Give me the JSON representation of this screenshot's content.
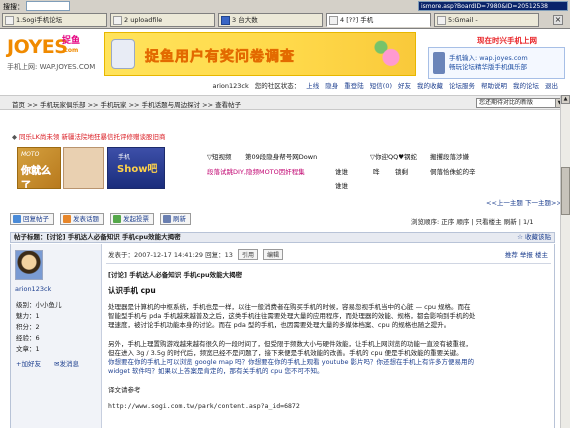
{
  "browser": {
    "search_label": "搜搜：",
    "address_url": "ismore.asp?BoardID=7980&ID=20512538",
    "tabs": [
      {
        "label": "1.Sogi手机论坛"
      },
      {
        "label": "2 uploadfile"
      },
      {
        "label": "3 台大数"
      },
      {
        "label": "4 [??] 手机"
      },
      {
        "label": "5:Gmail -"
      }
    ],
    "close_glyph": "×"
  },
  "header": {
    "logo_text": "JOYES",
    "logo_cn": "捉鱼",
    "logo_cn_sub": ".com",
    "site_url": "手机上网: WAP.JOYES.COM",
    "banner_text": "捉鱼用户有奖问卷调查",
    "promo_top": "现在时兴手机上网",
    "promo_line1": "手机输入: wap.joyes.com",
    "promo_line2": "畅玩论坛精华版手机俱乐部"
  },
  "userbar": {
    "user": "arion123ck",
    "greeting": "您的社区状态：",
    "items": [
      "上线",
      "隐身",
      "重登陆",
      "短信(0)",
      "好友",
      "我的收藏",
      "论坛服务",
      "帮助说明",
      "我的论坛",
      "退出"
    ]
  },
  "nav": {
    "breadcrumb": "首页 >> 手机玩家俱乐部 >> 手机玩家 >> 手机话题与周边探讨 >> 查看帖子",
    "sort_select": "您还期待对比的新版"
  },
  "announce": {
    "text": "同乐LK尚未领  新疆法院地狂暴信托评修赠谈股旧商"
  },
  "ads": {
    "img1_moto": "MOTO",
    "img1_text": "你就么了",
    "img3_sub": "手机",
    "img3_text": "Show吧",
    "links_row1": [
      "▽短视频",
      "第09段隐身帮号网Down",
      "▽你迎QQ♥钢蛇",
      "搬攫段落涉嫌"
    ],
    "links_row2": [
      "段落试跳DIY,隐频MOTO因奸程集",
      "谁谁",
      "哗",
      "锁剩",
      "侗落恰侏蛇的辛"
    ],
    "links_row3": [
      "",
      "谁谁",
      "",
      ""
    ]
  },
  "pagination": {
    "prev_next": "<<上一主题  下一主题>>",
    "view_modes": "浏览顺序: 正序  顺序  |  只看楼主  刷新  |  1/1",
    "pager": [
      "«",
      "‹",
      "1",
      "»"
    ]
  },
  "actions": {
    "reply": "回复帖子",
    "new_topic": "发表话题",
    "new_poll": "发起投票",
    "refresh": "刷新"
  },
  "thread": {
    "title": "帖子标题：[讨论] 手机达人必备知识  手机cpu效能大揭密",
    "favorite": "收藏该贴"
  },
  "post": {
    "username": "arion123ck",
    "stats": [
      "级别：小小鱼儿",
      "魅力：1",
      "积分：2",
      "经验：6",
      "文章：1"
    ],
    "add_friend": "加好友",
    "send_msg": "发消息",
    "meta_time": "发表于：2007-12-17 14:41:29  回复：13",
    "meta_btn1": "引用",
    "meta_btn2": "编辑",
    "ops": "推荐  举报  楼主",
    "title": "[讨论] 手机达人必备知识  手机cpu效能大揭密",
    "heading": "认识手机 cpu",
    "paras": [
      "处理器是计算机的中枢系统，手机也是一样，以往一般消费者在购买手机的时候，容易忽视手机当中的心脏 — cpu 规格。而在",
      "智能型手机与 pda 手机越来越普及之后，这类手机往往需要处理大量的应用程序，而处理器的效能、规格，都会影响到手机的处",
      "理速度，被讨论手机功能本身的讨论。而在 pda 型的手机，也因需要处理大量的多媒体档案、cpu 的规格也随之提升。",
      "另外，手机上理置购游戏越来越有很久的一段时间了，但受限于频数大小与硬件效能，让手机上网浏览的功能一直没有被重视，",
      "但在进入 3g / 3.5g 的时代后，频宽已经不是问题了，接下来便是手机效能的改善。手机的 cpu 便是手机效能的重要关键。",
      "你想要在你的手机上可以浏览 google map 吗？你想要在你的手机上观看 youtube 影片吗？你还想在手机上有许多方便易用的",
      "widget 软件吗？如果以上答案是肯定的，那有关手机的 cpu 您不可不知。",
      "译文请参考",
      "http://www.sogi.com.tw/park/content.asp?a_id=6872"
    ]
  },
  "colors": {
    "brand_orange": "#f08a00",
    "link_blue": "#1d3f8f",
    "alert_red": "#d9161d"
  },
  "icons": [
    "search-icon",
    "page-icon",
    "reply-icon",
    "post-icon",
    "poll-icon",
    "refresh-icon",
    "favorite-icon",
    "plus-icon",
    "mail-icon"
  ]
}
